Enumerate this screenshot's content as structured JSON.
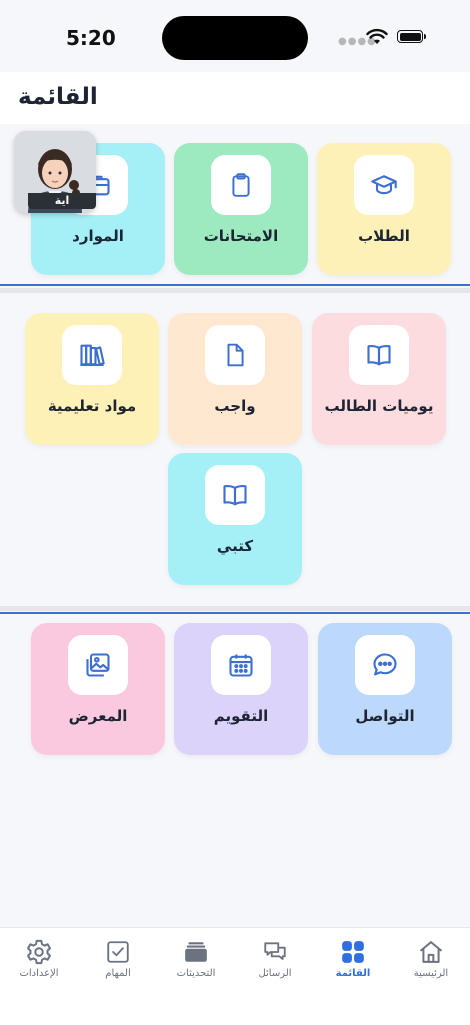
{
  "status_bar": {
    "time": "5:20"
  },
  "header": {
    "title": "القائمة"
  },
  "avatar": {
    "name": "اية"
  },
  "section1": {
    "tiles": [
      {
        "label": "الطلاب",
        "icon": "graduation-cap-icon"
      },
      {
        "label": "الامتحانات",
        "icon": "clipboard-icon"
      },
      {
        "label": "الموارد",
        "icon": "briefcase-icon"
      }
    ]
  },
  "section2": {
    "tiles": [
      {
        "label": "يوميات الطالب",
        "icon": "open-book-icon"
      },
      {
        "label": "واجب",
        "icon": "document-icon"
      },
      {
        "label": "مواد تعليمية",
        "icon": "books-icon"
      },
      {
        "label": "كتبي",
        "icon": "open-book-icon"
      }
    ]
  },
  "section3": {
    "tiles": [
      {
        "label": "التواصل",
        "icon": "chat-bubble-icon"
      },
      {
        "label": "التقويم",
        "icon": "calendar-icon"
      },
      {
        "label": "المعرض",
        "icon": "gallery-icon"
      }
    ]
  },
  "bottom_nav": {
    "items": [
      {
        "label": "الرئيسية",
        "icon": "home-icon"
      },
      {
        "label": "القائمة",
        "icon": "grid-icon",
        "active": true
      },
      {
        "label": "الرسائل",
        "icon": "messages-icon"
      },
      {
        "label": "التحديثات",
        "icon": "updates-icon"
      },
      {
        "label": "المهام",
        "icon": "checkbox-icon"
      },
      {
        "label": "الإعدادات",
        "icon": "gear-icon"
      }
    ]
  },
  "colors": {
    "accent": "#2f6fe0",
    "icon_blue": "#3d6fd0"
  }
}
